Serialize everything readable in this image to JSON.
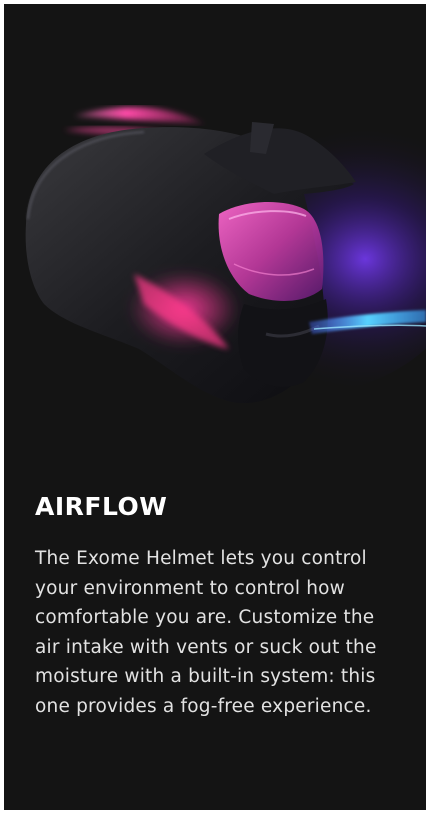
{
  "feature": {
    "image_subject": "helmet-image",
    "title": "AIRFLOW",
    "description": "The Exome Helmet lets you control your environment to control how comfortable you are. Customize the air intake with vents or suck out the moisture with a built-in system: this one provides a fog-free experience."
  },
  "colors": {
    "card_background": "#141414",
    "title": "#ffffff",
    "text": "#e2e2e2",
    "accent_pink": "#ff2a8a",
    "accent_purple": "#6a2cff",
    "accent_cyan": "#46c8ff"
  }
}
